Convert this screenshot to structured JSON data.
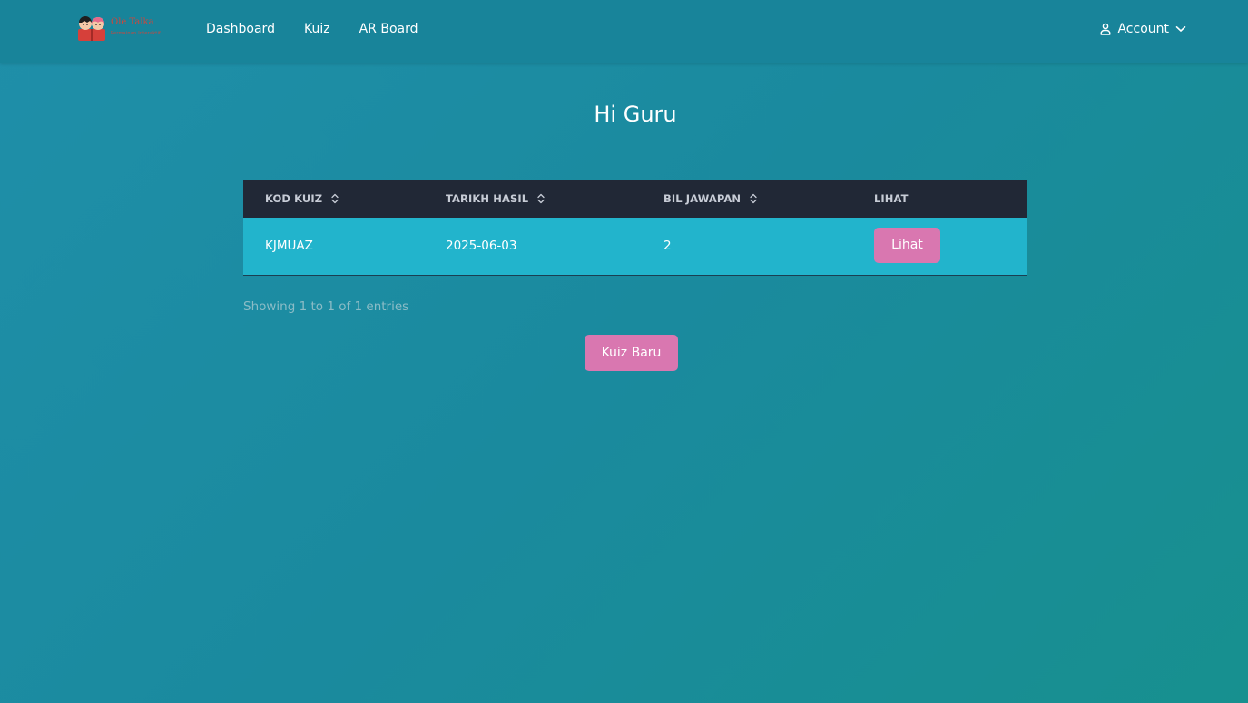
{
  "nav": {
    "logo": {
      "title": "Ole Talka",
      "subtitle": "Permainan Interaktif"
    },
    "links": [
      "Dashboard",
      "Kuiz",
      "AR Board"
    ],
    "account_label": "Account"
  },
  "page": {
    "title": "Hi Guru"
  },
  "table": {
    "columns": [
      "KOD KUIZ",
      "TARIKH HASIL",
      "BIL JAWAPAN",
      "LIHAT"
    ],
    "rows": [
      {
        "kod_kuiz": "KJMUAZ",
        "tarikh_hasil": "2025-06-03",
        "bil_jawapan": "2",
        "action_label": "Lihat"
      }
    ],
    "entries_info": "Showing 1 to 1 of 1 entries"
  },
  "actions": {
    "new_quiz_label": "Kuiz Baru"
  },
  "colors": {
    "background": "#1f8fa9",
    "navbar": "#18849a",
    "table_header": "#212836",
    "table_row": "#22b4cc",
    "button_pink": "#d977b0"
  },
  "icons": {
    "user": "user-icon",
    "chevron": "chevron-down-icon",
    "sort": "sort-icon"
  }
}
